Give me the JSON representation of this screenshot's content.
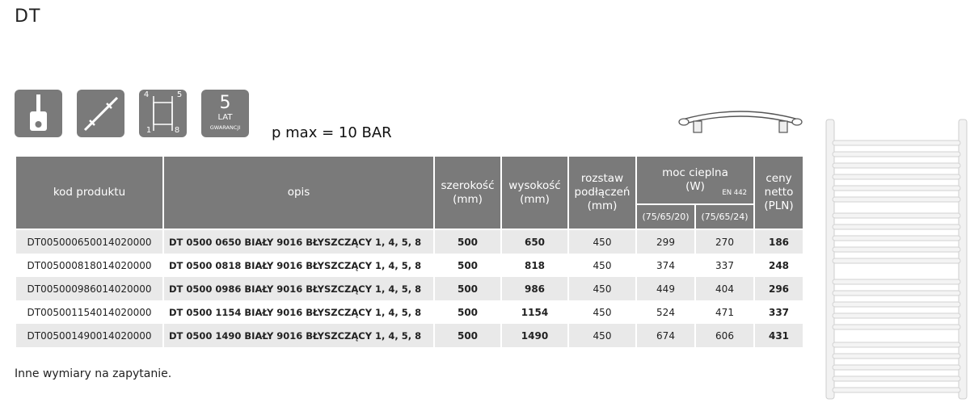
{
  "title": "DT",
  "icons": {
    "warranty_number": "5",
    "warranty_unit": "LAT",
    "warranty_label": "GWARANCJI",
    "dimension_labels": [
      "4",
      "5",
      "1",
      "8"
    ]
  },
  "pressure": "p max = 10 BAR",
  "table": {
    "headers": {
      "kod": "kod produktu",
      "opis": "opis",
      "szerokosc": [
        "szerokość",
        "(mm)"
      ],
      "wysokosc": [
        "wysokość",
        "(mm)"
      ],
      "rozstaw": [
        "rozstaw",
        "podłączeń",
        "(mm)"
      ],
      "moc": [
        "moc cieplna",
        "(W)"
      ],
      "moc_norm": "EN 442",
      "moc_sub": [
        "(75/65/20)",
        "(75/65/24)"
      ],
      "ceny": [
        "ceny",
        "netto",
        "(PLN)"
      ]
    },
    "rows": [
      {
        "kod": "DT005000650014020000",
        "opis": "DT 0500 0650 BIAŁY 9016 BŁYSZCZĄCY 1, 4, 5, 8",
        "szer": "500",
        "wys": "650",
        "rozstaw": "450",
        "moc20": "299",
        "moc24": "270",
        "cena": "186"
      },
      {
        "kod": "DT005000818014020000",
        "opis": "DT 0500 0818 BIAŁY 9016 BŁYSZCZĄCY 1, 4, 5, 8",
        "szer": "500",
        "wys": "818",
        "rozstaw": "450",
        "moc20": "374",
        "moc24": "337",
        "cena": "248"
      },
      {
        "kod": "DT005000986014020000",
        "opis": "DT 0500 0986 BIAŁY 9016 BŁYSZCZĄCY 1, 4, 5, 8",
        "szer": "500",
        "wys": "986",
        "rozstaw": "450",
        "moc20": "449",
        "moc24": "404",
        "cena": "296"
      },
      {
        "kod": "DT005001154014020000",
        "opis": "DT 0500 1154 BIAŁY 9016 BŁYSZCZĄCY 1, 4, 5, 8",
        "szer": "500",
        "wys": "1154",
        "rozstaw": "450",
        "moc20": "524",
        "moc24": "471",
        "cena": "337"
      },
      {
        "kod": "DT005001490014020000",
        "opis": "DT 0500 1490 BIAŁY 9016 BŁYSZCZĄCY 1, 4, 5, 8",
        "szer": "500",
        "wys": "1490",
        "rozstaw": "450",
        "moc20": "674",
        "moc24": "606",
        "cena": "431"
      }
    ]
  },
  "note": "Inne wymiary na zapytanie.",
  "colors": {
    "header_bg": "#7a7a7a",
    "row_alt": "#e9e9e9",
    "icon_bg": "#7a7a7a"
  }
}
